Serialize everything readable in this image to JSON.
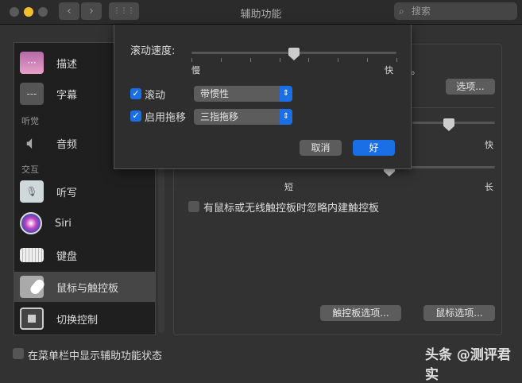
{
  "window": {
    "title": "辅助功能",
    "search_placeholder": "搜索",
    "back": "‹",
    "forward": "›",
    "grid": "⋮⋮⋮"
  },
  "sidebar": {
    "items": [
      {
        "label": "描述",
        "icon": "description-icon"
      },
      {
        "label": "字幕",
        "icon": "captions-icon"
      },
      {
        "label": "音频",
        "icon": "speaker-icon"
      },
      {
        "label": "听写",
        "icon": "microphone-icon"
      },
      {
        "label": "Siri",
        "icon": "siri-icon"
      },
      {
        "label": "键盘",
        "icon": "keyboard-icon"
      },
      {
        "label": "鼠标与触控板",
        "icon": "mouse-trackpad-icon",
        "selected": true
      },
      {
        "label": "切换控制",
        "icon": "switch-control-icon"
      }
    ],
    "sections": {
      "hearing": "听觉",
      "interaction": "交互"
    }
  },
  "footer": {
    "show_status_label": "在菜单栏中显示辅助功能状态",
    "show_status_checked": false
  },
  "panel": {
    "partial_text": "计。",
    "options_button": "选项...",
    "speed_fast": "快",
    "delay_short": "短",
    "delay_long": "长",
    "ignore_trackpad_label": "有鼠标或无线触控板时忽略内建触控板",
    "ignore_trackpad_checked": false,
    "trackpad_options": "触控板选项...",
    "mouse_options": "鼠标选项..."
  },
  "sheet": {
    "scroll_speed_label": "滚动速度:",
    "slow": "慢",
    "fast": "快",
    "scroll_speed_value": 0.5,
    "scroll_label": "滚动",
    "scroll_checked": true,
    "scroll_option": "带惯性",
    "drag_label": "启用拖移",
    "drag_checked": true,
    "drag_option": "三指拖移",
    "cancel": "取消",
    "ok": "好"
  },
  "watermark": "头条 @测评君实",
  "colors": {
    "accent": "#1a6ee6",
    "background": "#323232"
  }
}
